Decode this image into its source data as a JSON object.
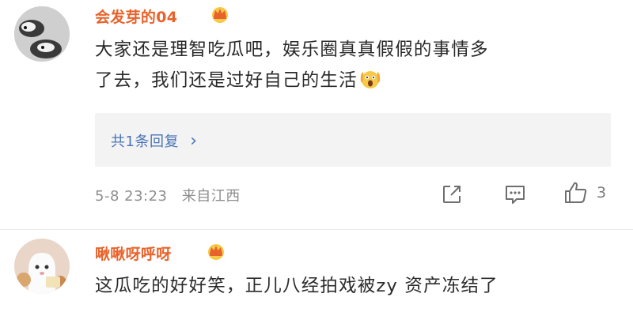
{
  "comments": [
    {
      "username": "会发芽的04",
      "text_line1": "大家还是理智吃瓜吧，娱乐圈真真假假的事情多",
      "text_line2": "了去，我们还是过好自己的生活",
      "reply_summary": "共1条回复",
      "reply_chevron": "›",
      "timestamp": "5-8 23:23",
      "location": "来自江西",
      "like_count": "3"
    },
    {
      "username": "啾啾呀呼呀",
      "text_line1": "这瓜吃的好好笑，正儿八经拍戏被zy 资产冻结了"
    }
  ],
  "icons": {
    "crown": "crown-badge-icon",
    "share": "share-icon",
    "comment": "comment-icon",
    "like": "thumbs-up-icon",
    "emoji": "scream-emoji-icon"
  },
  "colors": {
    "username": "#e8632b",
    "reply_link": "#4a74b5",
    "meta": "#8e8e8e",
    "reply_bg": "#f3f3f4"
  }
}
